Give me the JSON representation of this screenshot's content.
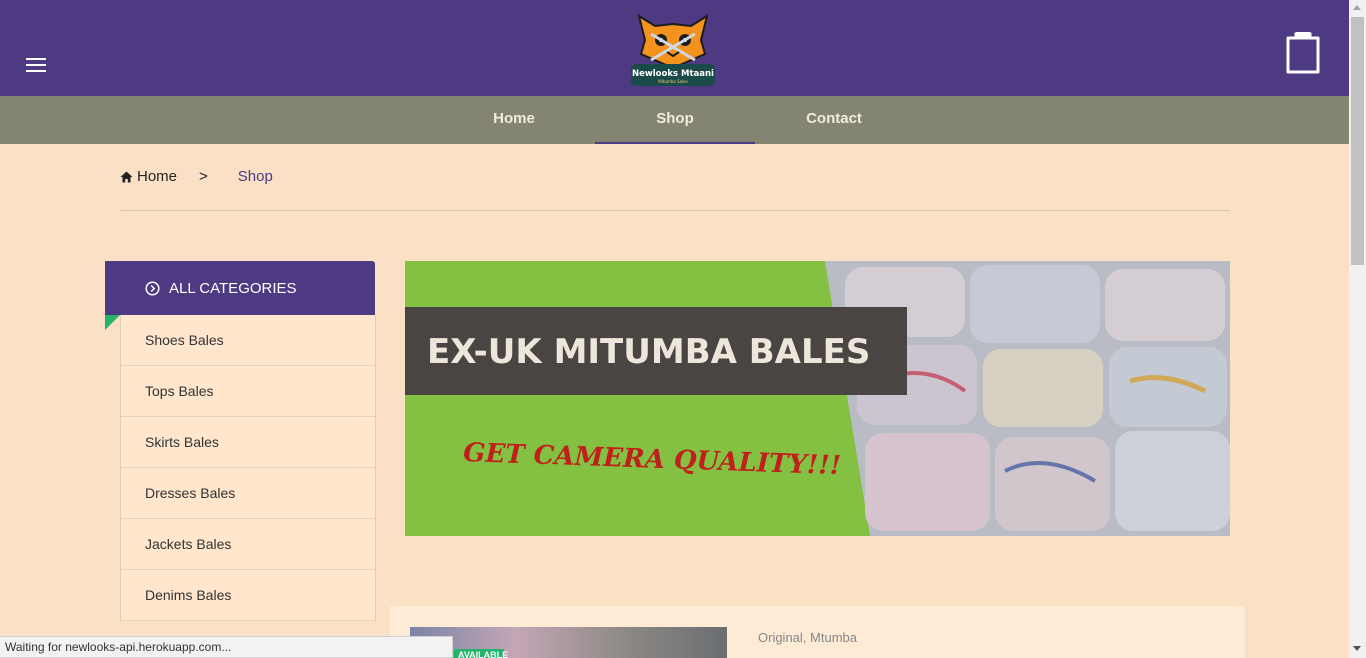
{
  "header": {
    "menu_icon": "hamburger-menu-icon",
    "logo": {
      "name": "Newlooks Mtaani",
      "tagline": "Mitumba Sales",
      "icon": "cat-mascot-logo"
    },
    "cart_icon": "shopping-bag-icon"
  },
  "nav": {
    "items": [
      {
        "label": "Home"
      },
      {
        "label": "Shop",
        "active": true
      },
      {
        "label": "Contact"
      }
    ]
  },
  "breadcrumb": {
    "home_icon": "home-icon",
    "home": "Home",
    "separator": ">",
    "current": "Shop"
  },
  "categories": {
    "icon": "circle-chevron-right-icon",
    "title": "ALL CATEGORIES",
    "items": [
      {
        "label": "Shoes Bales"
      },
      {
        "label": "Tops Bales"
      },
      {
        "label": "Skirts Bales"
      },
      {
        "label": "Dresses Bales"
      },
      {
        "label": "Jackets Bales"
      },
      {
        "label": "Denims Bales"
      }
    ]
  },
  "banner": {
    "headline": "EX-UK MITUMBA BALES",
    "tagline": "GET CAMERA QUALITY!!!"
  },
  "product": {
    "badge": "AVAILABLE",
    "tags": "Original, Mtumba"
  },
  "status": {
    "text": "Waiting for newlooks-api.herokuapp.com..."
  },
  "colors": {
    "header": "#4d3a83",
    "nav": "#838572",
    "page_bg": "#fae1c6",
    "banner_green": "#84c041",
    "accent_green": "#23b36b",
    "banner_text_red": "#c0201b"
  }
}
